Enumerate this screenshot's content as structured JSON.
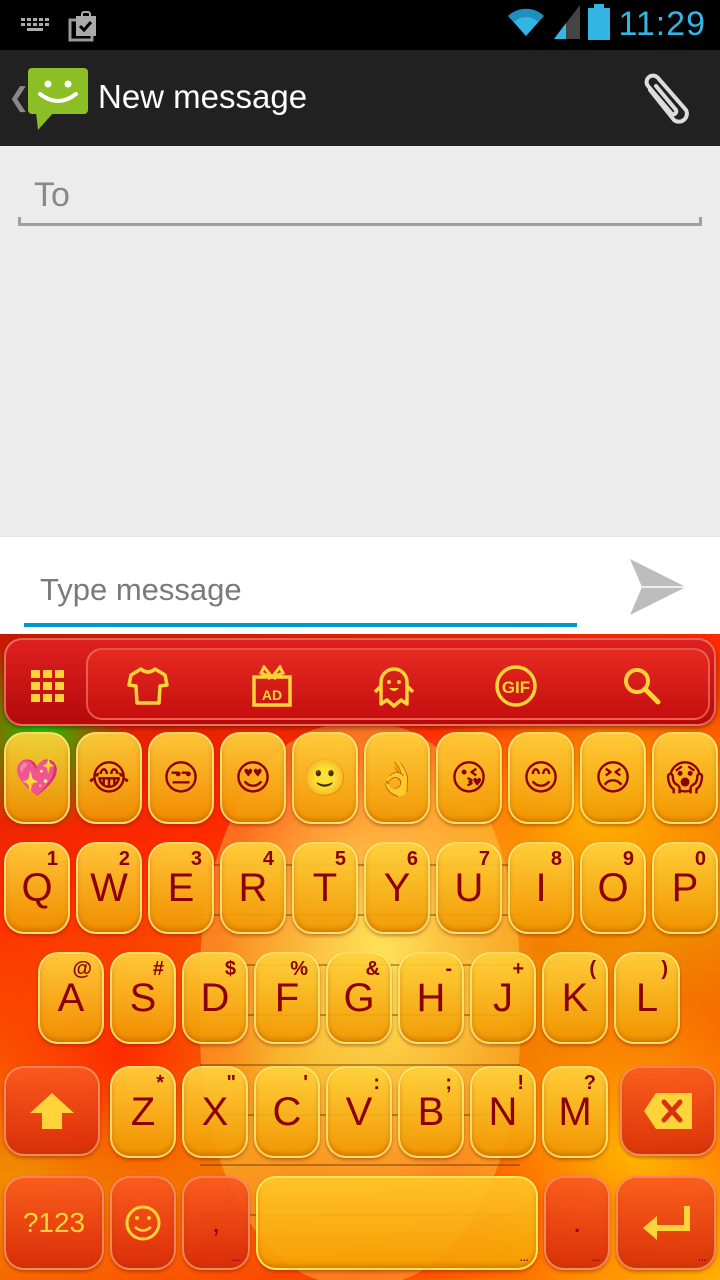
{
  "status_bar": {
    "time": "11:29",
    "icons": [
      "keyboard-icon",
      "clipboard-check-icon",
      "wifi-icon",
      "signal-icon",
      "battery-icon"
    ]
  },
  "action_bar": {
    "title": "New message",
    "back_icon": "chevron-left-icon",
    "app_icon": "messaging-smiley-icon",
    "attach_icon": "paperclip-icon"
  },
  "compose": {
    "to_placeholder": "To",
    "message_placeholder": "Type message",
    "send_icon": "send-icon"
  },
  "keyboard": {
    "colors": {
      "accent": "#ffd43a",
      "key_text": "#8b0000",
      "toolbar": "#cc1414"
    },
    "toolbar": [
      {
        "name": "apps-grid-icon"
      },
      {
        "name": "theme-shirt-icon"
      },
      {
        "name": "ad-gift-icon"
      },
      {
        "name": "sticker-ghost-icon"
      },
      {
        "name": "gif-icon",
        "label": "GIF"
      },
      {
        "name": "search-icon"
      }
    ],
    "emoji_row": [
      "💖",
      "😂",
      "😒",
      "😍",
      "🙂",
      "👌",
      "😘",
      "😊",
      "😣",
      "😱"
    ],
    "row1": [
      {
        "k": "Q",
        "s": "1"
      },
      {
        "k": "W",
        "s": "2"
      },
      {
        "k": "E",
        "s": "3"
      },
      {
        "k": "R",
        "s": "4"
      },
      {
        "k": "T",
        "s": "5"
      },
      {
        "k": "Y",
        "s": "6"
      },
      {
        "k": "U",
        "s": "7"
      },
      {
        "k": "I",
        "s": "8"
      },
      {
        "k": "O",
        "s": "9"
      },
      {
        "k": "P",
        "s": "0"
      }
    ],
    "row2": [
      {
        "k": "A",
        "s": "@"
      },
      {
        "k": "S",
        "s": "#"
      },
      {
        "k": "D",
        "s": "$"
      },
      {
        "k": "F",
        "s": "%"
      },
      {
        "k": "G",
        "s": "&"
      },
      {
        "k": "H",
        "s": "-"
      },
      {
        "k": "J",
        "s": "+"
      },
      {
        "k": "K",
        "s": "("
      },
      {
        "k": "L",
        "s": ")"
      }
    ],
    "row3": [
      {
        "k": "Z",
        "s": "*"
      },
      {
        "k": "X",
        "s": "\""
      },
      {
        "k": "C",
        "s": "'"
      },
      {
        "k": "V",
        "s": ":"
      },
      {
        "k": "B",
        "s": ";"
      },
      {
        "k": "N",
        "s": "!"
      },
      {
        "k": "M",
        "s": "?"
      }
    ],
    "symbols_label": "?123",
    "comma": ",",
    "period": ".",
    "more_dots": "..."
  }
}
